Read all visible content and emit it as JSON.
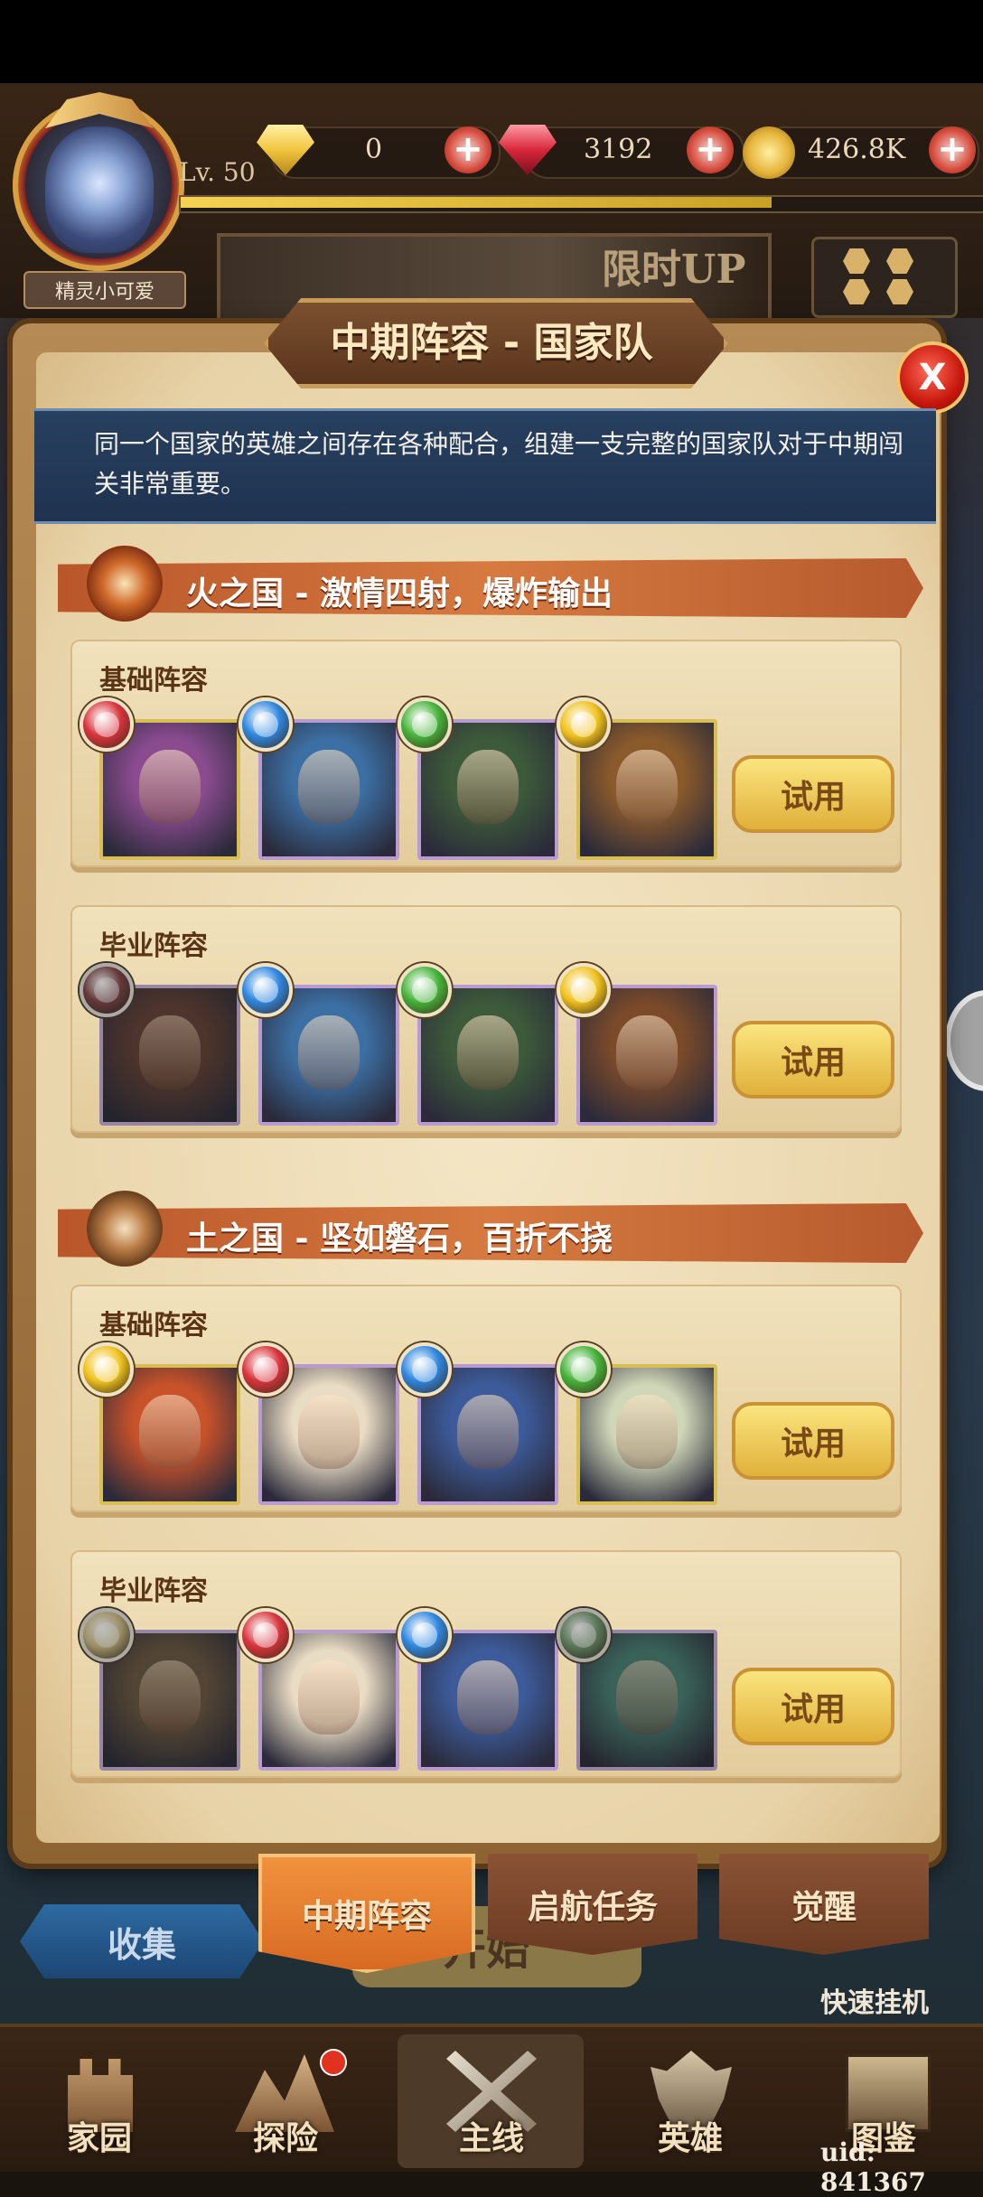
{
  "player": {
    "name": "精灵小可爱",
    "level": "Lv. 50",
    "xp_progress": 0.74
  },
  "resources": [
    {
      "name": "gold-diamond",
      "value": "0",
      "color": "#f2c53e"
    },
    {
      "name": "red-gem",
      "value": "3192",
      "color": "#d8263a"
    },
    {
      "name": "gold-coin",
      "value": "426.8K",
      "color": "#e5b43a"
    }
  ],
  "banner": {
    "label": "限时UP"
  },
  "dialog": {
    "title": "中期阵容 - 国家队",
    "close_label": "X",
    "description": "同一个国家的英雄之间存在各种配合，组建一支完整的国家队对于中期闯关非常重要。",
    "sections": [
      {
        "title": "火之国 - 激情四射，爆炸输出",
        "icon": "fire-nation-emblem-icon",
        "lineups": [
          {
            "label": "基础阵容",
            "try_label": "试用",
            "heroes": [
              {
                "element": "fire",
                "element_color": "#d8343c",
                "rarity": "gold",
                "portrait": "#8a4b8f",
                "owned": true
              },
              {
                "element": "water",
                "element_color": "#2e86e0",
                "rarity": "purple",
                "portrait": "#3c6fa3",
                "owned": true
              },
              {
                "element": "wind",
                "element_color": "#46b33a",
                "rarity": "purple",
                "portrait": "#3d5a3a",
                "owned": true
              },
              {
                "element": "light",
                "element_color": "#f0c21e",
                "rarity": "gold",
                "portrait": "#8a5a2b",
                "owned": true
              }
            ]
          },
          {
            "label": "毕业阵容",
            "try_label": "试用",
            "heroes": [
              {
                "element": "fire",
                "element_color": "#d8343c",
                "rarity": "purple",
                "portrait": "#6a3a2a",
                "owned": false
              },
              {
                "element": "water",
                "element_color": "#2e86e0",
                "rarity": "purple",
                "portrait": "#3c6fa3",
                "owned": true
              },
              {
                "element": "wind",
                "element_color": "#46b33a",
                "rarity": "purple",
                "portrait": "#3d5a3a",
                "owned": true
              },
              {
                "element": "light",
                "element_color": "#f0c21e",
                "rarity": "purple",
                "portrait": "#7a4a2a",
                "owned": true
              }
            ]
          }
        ]
      },
      {
        "title": "土之国 - 坚如磐石，百折不挠",
        "icon": "earth-nation-emblem-icon",
        "lineups": [
          {
            "label": "基础阵容",
            "try_label": "试用",
            "heroes": [
              {
                "element": "light",
                "element_color": "#f0c21e",
                "rarity": "gold",
                "portrait": "#c8522a",
                "owned": true
              },
              {
                "element": "fire",
                "element_color": "#d8343c",
                "rarity": "purple",
                "portrait": "#e9dcc4",
                "owned": true
              },
              {
                "element": "water",
                "element_color": "#2e86e0",
                "rarity": "purple",
                "portrait": "#3d5b9a",
                "owned": true
              },
              {
                "element": "wind",
                "element_color": "#46b33a",
                "rarity": "gold",
                "portrait": "#cfd7b8",
                "owned": true
              }
            ]
          },
          {
            "label": "毕业阵容",
            "try_label": "试用",
            "heroes": [
              {
                "element": "light",
                "element_color": "#f0c21e",
                "rarity": "purple",
                "portrait": "#6a5030",
                "owned": false
              },
              {
                "element": "fire",
                "element_color": "#d8343c",
                "rarity": "purple",
                "portrait": "#e9dcc4",
                "owned": true
              },
              {
                "element": "water",
                "element_color": "#2e86e0",
                "rarity": "purple",
                "portrait": "#3d5b9a",
                "owned": true
              },
              {
                "element": "wind",
                "element_color": "#46b33a",
                "rarity": "purple",
                "portrait": "#2c7a6a",
                "owned": false
              }
            ]
          }
        ]
      }
    ],
    "tabs": [
      {
        "label": "中期阵容",
        "active": true
      },
      {
        "label": "启航任务",
        "active": false
      },
      {
        "label": "觉醒",
        "active": false
      }
    ]
  },
  "under_dialog": {
    "collect_label": "收集",
    "start_label": "开始",
    "quick_afk_label": "快速挂机"
  },
  "bottom_nav": [
    {
      "label": "家园",
      "icon": "castle-icon"
    },
    {
      "label": "探险",
      "icon": "mountain-icon"
    },
    {
      "label": "主线",
      "icon": "crossed-swords-icon",
      "active": true
    },
    {
      "label": "英雄",
      "icon": "hero-helmet-icon"
    },
    {
      "label": "图鉴",
      "icon": "book-icon"
    }
  ],
  "uid": "uid: 841367"
}
